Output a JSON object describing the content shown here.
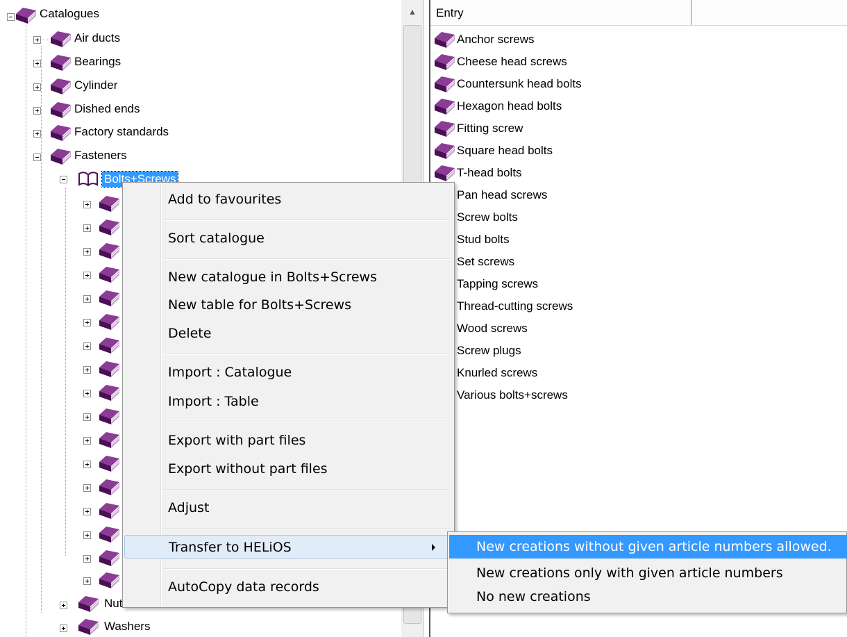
{
  "tree": {
    "root": "Catalogues",
    "level1": [
      "Air ducts",
      "Bearings",
      "Cylinder",
      "Dished ends",
      "Factory standards",
      "Fasteners"
    ],
    "selected": "Bolts+Screws",
    "after": [
      "Nuts",
      "Washers"
    ]
  },
  "list": {
    "column_header": "Entry",
    "entries": [
      "Anchor screws",
      "Cheese head screws",
      "Countersunk head bolts",
      "Hexagon head bolts",
      "Fitting screw",
      "Square head bolts",
      "T-head bolts",
      "Pan head screws",
      "Screw bolts",
      "Stud bolts",
      "Set screws",
      "Tapping screws",
      "Thread-cutting screws",
      "Wood screws",
      "Screw plugs",
      "Knurled screws",
      "Various bolts+screws"
    ]
  },
  "context_menu": {
    "items": [
      "Add to favourites",
      "Sort catalogue",
      "New catalogue in Bolts+Screws",
      "New table for Bolts+Screws",
      "Delete",
      "Import : Catalogue",
      "Import : Table",
      "Export with part files",
      "Export without part files",
      "Adjust",
      "Transfer to HELiOS",
      "AutoCopy data records"
    ],
    "highlighted": "Transfer to HELiOS"
  },
  "submenu": {
    "items": [
      "New creations without given article numbers allowed.",
      "New creations only with given article numbers",
      "No new creations"
    ],
    "highlighted": "New creations without given article numbers allowed."
  },
  "icons": {
    "catalogue": "catalogue-book-icon",
    "open_catalogue": "open-book-icon",
    "expand": "plus-box-icon",
    "collapse": "minus-box-icon",
    "submenu_arrow": "chevron-right-icon",
    "scroll_up": "scroll-up-arrow-icon"
  },
  "colors": {
    "selection": "#3399ff",
    "book_purple": "#6b1f73",
    "menu_background": "#f1f1f1",
    "menu_hover": "#e1ecf8"
  }
}
